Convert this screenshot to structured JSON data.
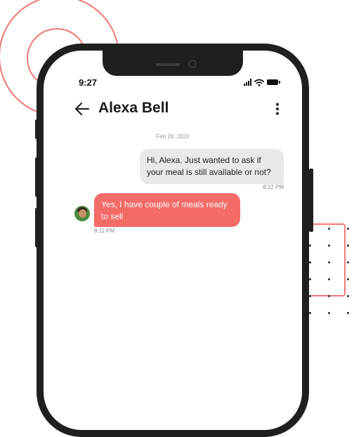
{
  "status_bar": {
    "time": "9:27"
  },
  "header": {
    "title": "Alexa Bell"
  },
  "conversation": {
    "date": "Feb 28, 2020",
    "messages": [
      {
        "direction": "outgoing",
        "text": "Hi, Alexa. Just wanted to ask if your meal is still available or not?",
        "time": "8:22 PM"
      },
      {
        "direction": "incoming",
        "text": "Yes, I have couple of meals ready to sell",
        "time": "8:11 PM"
      }
    ]
  },
  "colors": {
    "accent": "#f36b67",
    "outgoing_bubble": "#e9e9e9",
    "phone_frame": "#1f1f1f"
  }
}
